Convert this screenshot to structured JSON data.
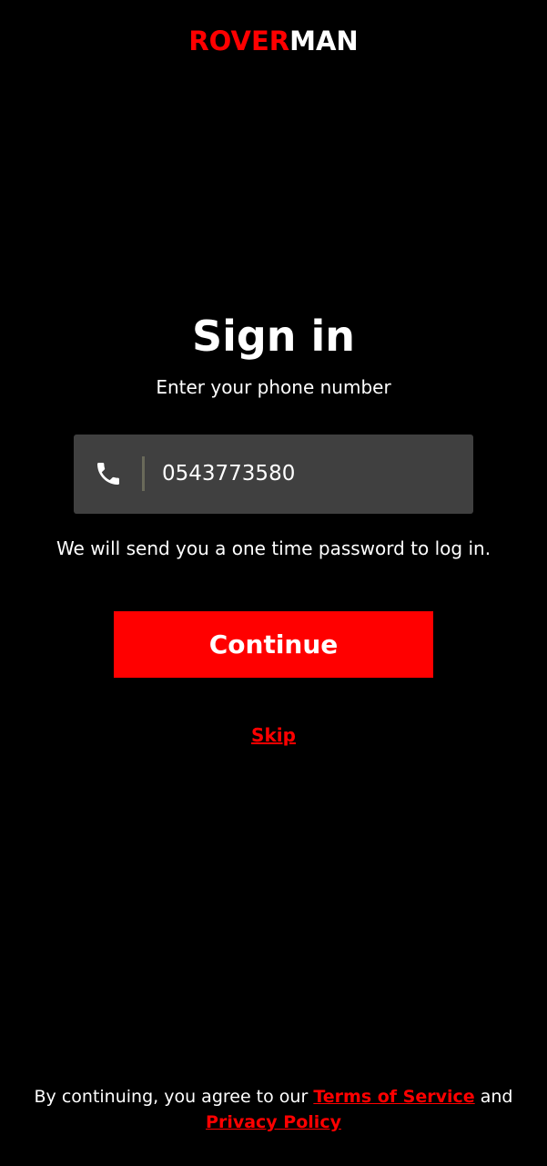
{
  "logo": {
    "part1": "ROVER",
    "part2": "MAN"
  },
  "colors": {
    "brand_red": "#ff0000",
    "background": "#000000",
    "field_bg": "#404040",
    "text": "#ffffff"
  },
  "title": "Sign in",
  "subtitle": "Enter your phone number",
  "phone_field": {
    "icon": "phone-icon",
    "value": "0543773580"
  },
  "otp_note": "We will send you a one time password to log in.",
  "continue_label": "Continue",
  "skip_label": "Skip",
  "legal": {
    "prefix": "By continuing, you agree to our ",
    "terms_label": "Terms of Service",
    "and": " and",
    "privacy_label": "Privacy Policy"
  }
}
